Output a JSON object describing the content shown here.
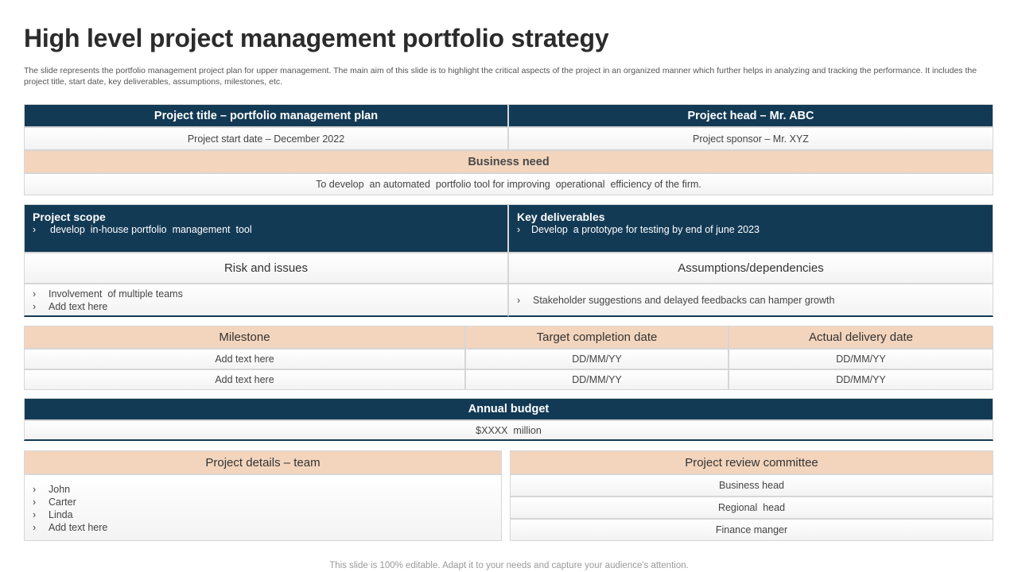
{
  "title": "High level project management portfolio strategy",
  "description": "The slide represents the portfolio management project plan for upper management. The main aim of this slide is to highlight the critical aspects of the project in an organized manner which further helps in analyzing and tracking the performance. It includes the project title, start date, key deliverables, assumptions, milestones, etc.",
  "overview": {
    "project_title": "Project title – portfolio management plan",
    "project_head": "Project head – Mr. ABC",
    "start_date": "Project start date – December 2022",
    "sponsor": "Project sponsor – Mr. XYZ",
    "business_need_label": "Business need",
    "business_need_text": "To develop  an automated  portfolio tool for improving  operational  efficiency of the firm."
  },
  "scope": {
    "scope_label": "Project scope",
    "scope_items": [
      "develop  in-house portfolio  management  tool"
    ],
    "deliverables_label": "Key deliverables",
    "deliverables_items": [
      "Develop  a prototype for testing by end of june 2023"
    ],
    "risk_label": "Risk and issues",
    "risk_items": [
      "Involvement  of multiple teams",
      "Add text here"
    ],
    "assumptions_label": "Assumptions/dependencies",
    "assumptions_items": [
      "Stakeholder suggestions and delayed feedbacks can hamper growth"
    ]
  },
  "milestones": {
    "headers": [
      "Milestone",
      "Target completion date",
      "Actual delivery date"
    ],
    "rows": [
      [
        "Add text here",
        "DD/MM/YY",
        "DD/MM/YY"
      ],
      [
        "Add text here",
        "DD/MM/YY",
        "DD/MM/YY"
      ]
    ]
  },
  "budget": {
    "label": "Annual budget",
    "value": "$XXXX  million"
  },
  "team": {
    "label": "Project details – team",
    "members": [
      "John",
      "Carter",
      "Linda",
      "Add text here"
    ]
  },
  "committee": {
    "label": "Project review committee",
    "members": [
      "Business head",
      "Regional  head",
      "Finance manger"
    ]
  },
  "bullet_glyph": "›",
  "footer": "This slide is 100% editable. Adapt it to your needs and capture your audience's attention.",
  "colors": {
    "navy": "#133a55",
    "peach": "#f3d5bd",
    "border": "#d6d6d6"
  }
}
